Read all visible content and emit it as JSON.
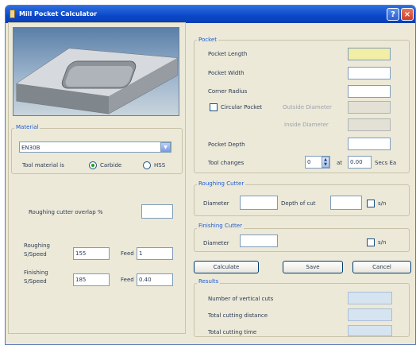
{
  "window": {
    "title": "Mill Pocket Calculator"
  },
  "left": {
    "material": {
      "group_label": "Material",
      "selected": "EN30B"
    },
    "tool_material": {
      "label": "Tool material is",
      "options": [
        "Carbide",
        "HSS"
      ],
      "selected": "Carbide"
    },
    "overlap": {
      "label": "Roughing cutter overlap %",
      "value": ""
    },
    "roughing": {
      "label_line1": "Roughing",
      "label_line2": "S/Speed",
      "speed": "155",
      "feed_label": "Feed",
      "feed": "1"
    },
    "finishing": {
      "label_line1": "Finishing",
      "label_line2": "S/Speed",
      "speed": "185",
      "feed_label": "Feed",
      "feed": "0.40"
    }
  },
  "pocket": {
    "group_label": "Pocket",
    "length_label": "Pocket Length",
    "length": "",
    "width_label": "Pocket Width",
    "width": "",
    "corner_label": "Corner Radius",
    "corner": "",
    "circular_label": "Circular Pocket",
    "outside_label": "Outside Diameter",
    "inside_label": "Inside Diameter",
    "depth_label": "Pocket Depth",
    "depth": "",
    "toolchanges_label": "Tool changes",
    "toolchanges": "0",
    "at_label": "at",
    "secs": "0.00",
    "secs_label": "Secs Ea"
  },
  "roughing_cutter": {
    "group_label": "Roughing Cutter",
    "diameter_label": "Diameter",
    "diameter": "",
    "depth_label": "Depth of cut",
    "depth": "",
    "sn_label": "s/n"
  },
  "finishing_cutter": {
    "group_label": "Finishing Cutter",
    "diameter_label": "Diameter",
    "diameter": "",
    "sn_label": "s/n"
  },
  "buttons": {
    "calculate": "Calculate",
    "save": "Save",
    "cancel": "Cancel"
  },
  "results": {
    "group_label": "Results",
    "vertical_cuts_label": "Number of vertical cuts",
    "distance_label": "Total cutting distance",
    "time_label": "Total cutting time"
  },
  "icons": [
    "app-icon",
    "help-icon",
    "close-icon",
    "dropdown-arrow-icon",
    "spinner-icon"
  ],
  "colors": {
    "title_bar": "#0a47c8",
    "group_label": "#1e5bd6",
    "highlight_field": "#f3eea6",
    "result_field": "#d6e4f2"
  }
}
